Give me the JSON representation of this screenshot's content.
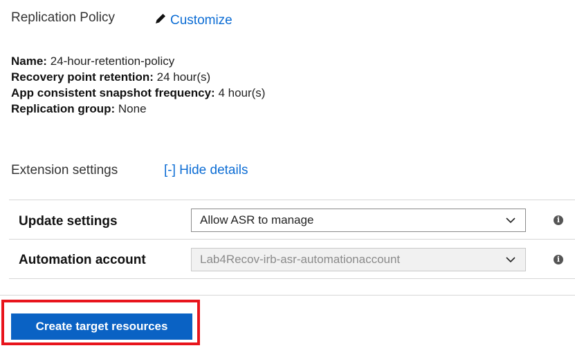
{
  "replication_policy": {
    "title": "Replication Policy",
    "customize_label": "Customize",
    "details": [
      {
        "label": "Name:",
        "value": "24-hour-retention-policy"
      },
      {
        "label": "Recovery point retention:",
        "value": "24 hour(s)"
      },
      {
        "label": "App consistent snapshot frequency:",
        "value": "4 hour(s)"
      },
      {
        "label": "Replication group:",
        "value": "None"
      }
    ]
  },
  "extension_settings": {
    "title": "Extension settings",
    "toggle_label": "[-] Hide details",
    "rows": [
      {
        "label": "Update settings",
        "value": "Allow ASR to manage",
        "disabled": false
      },
      {
        "label": "Automation account",
        "value": "Lab4Recov-irb-asr-automationaccount",
        "disabled": true
      }
    ]
  },
  "actions": {
    "create_label": "Create target resources"
  },
  "colors": {
    "link": "#0b6cd4",
    "primary_button": "#0a62c4",
    "highlight": "#e8141c"
  },
  "icons": {
    "edit": "pencil-icon",
    "dropdown": "chevron-down-icon",
    "info": "info-icon"
  }
}
